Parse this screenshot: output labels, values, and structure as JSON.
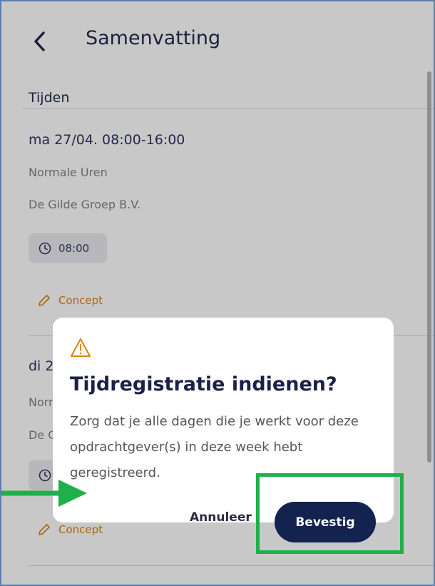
{
  "header": {
    "title": "Samenvatting",
    "back_icon": "chevron-left-icon"
  },
  "section": {
    "title": "Tijden"
  },
  "entries": [
    {
      "date": "ma 27/04. 08:00-16:00",
      "type": "Normale Uren",
      "company": "De Gilde Groep B.V.",
      "duration": "08:00",
      "status": "Concept"
    },
    {
      "date": "di 2",
      "type": "Norr",
      "company": "De C",
      "status": "Concept"
    }
  ],
  "modal": {
    "icon": "warning-icon",
    "title": "Tijdregistratie indienen?",
    "body": "Zorg dat je alle dagen die je werkt voor deze opdrachtgever(s) in deze week hebt geregistreerd.",
    "cancel_label": "Annuleer",
    "confirm_label": "Bevestig"
  },
  "colors": {
    "primary": "#13224f",
    "status": "#a9670f",
    "annotation": "#1fb04b"
  }
}
